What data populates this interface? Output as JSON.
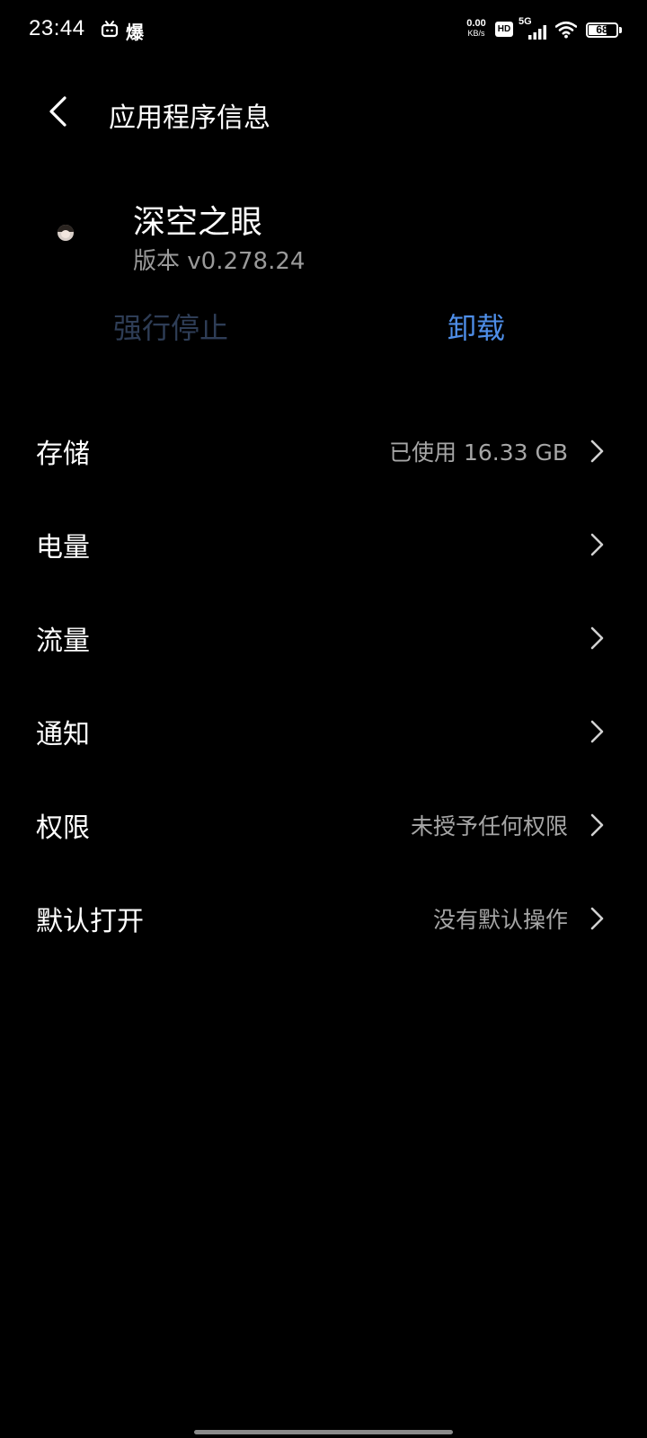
{
  "status_bar": {
    "time": "23:44",
    "notification_text": "爆",
    "net_speed_value": "0.00",
    "net_speed_unit": "KB/s",
    "hd_label": "HD",
    "network_type": "5G",
    "battery_level": "68",
    "battery_fraction": 0.68
  },
  "header": {
    "title": "应用程序信息"
  },
  "app": {
    "name": "深空之眼",
    "version": "版本 v0.278.24"
  },
  "actions": {
    "force_stop_label": "强行停止",
    "uninstall_label": "卸载"
  },
  "settings": [
    {
      "label": "存储",
      "value": "已使用 16.33 GB"
    },
    {
      "label": "电量",
      "value": ""
    },
    {
      "label": "流量",
      "value": ""
    },
    {
      "label": "通知",
      "value": ""
    },
    {
      "label": "权限",
      "value": "未授予任何权限"
    },
    {
      "label": "默认打开",
      "value": "没有默认操作"
    }
  ],
  "colors": {
    "background": "#000000",
    "accent": "#4e8ee8",
    "disabled": "#2e3d56",
    "secondary_text": "#a6a6a6"
  }
}
